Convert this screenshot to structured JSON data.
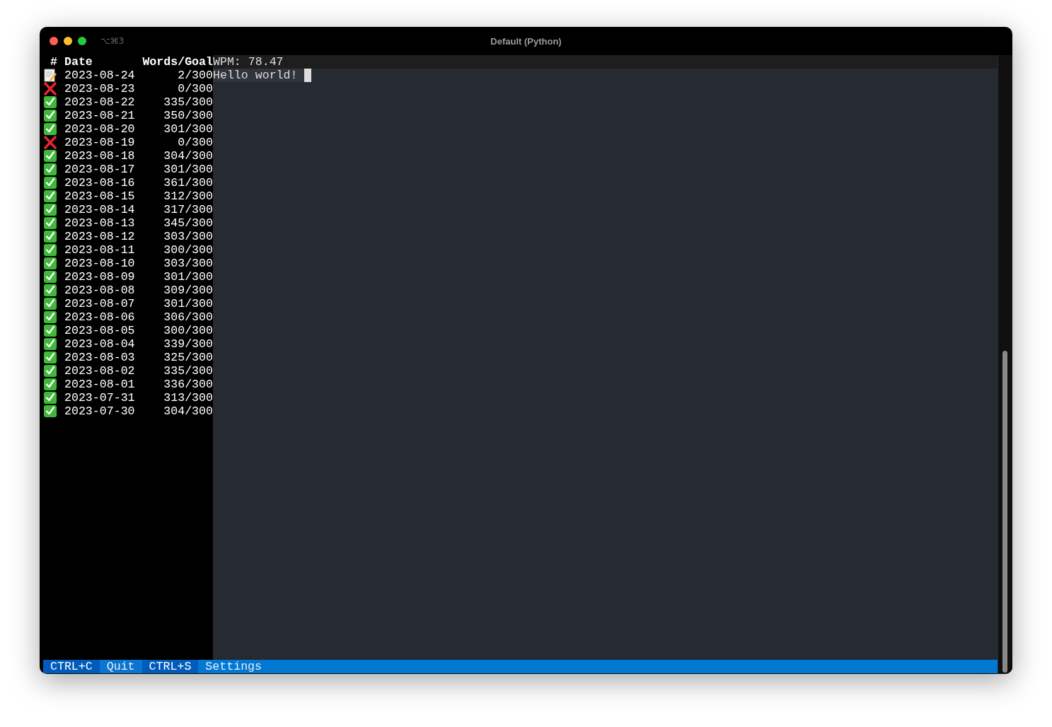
{
  "window": {
    "title": "Default (Python)",
    "shortcut": "⌥⌘3"
  },
  "log": {
    "columns": [
      "#",
      "Date",
      "Words/Goal"
    ],
    "rows": [
      {
        "kind": "draft",
        "date": "2023-08-24",
        "words": "2/300"
      },
      {
        "kind": "missed",
        "date": "2023-08-23",
        "words": "0/300"
      },
      {
        "kind": "done",
        "date": "2023-08-22",
        "words": "335/300"
      },
      {
        "kind": "done",
        "date": "2023-08-21",
        "words": "350/300"
      },
      {
        "kind": "done",
        "date": "2023-08-20",
        "words": "301/300"
      },
      {
        "kind": "missed",
        "date": "2023-08-19",
        "words": "0/300"
      },
      {
        "kind": "done",
        "date": "2023-08-18",
        "words": "304/300"
      },
      {
        "kind": "done",
        "date": "2023-08-17",
        "words": "301/300"
      },
      {
        "kind": "done",
        "date": "2023-08-16",
        "words": "361/300"
      },
      {
        "kind": "done",
        "date": "2023-08-15",
        "words": "312/300"
      },
      {
        "kind": "done",
        "date": "2023-08-14",
        "words": "317/300"
      },
      {
        "kind": "done",
        "date": "2023-08-13",
        "words": "345/300"
      },
      {
        "kind": "done",
        "date": "2023-08-12",
        "words": "303/300"
      },
      {
        "kind": "done",
        "date": "2023-08-11",
        "words": "300/300"
      },
      {
        "kind": "done",
        "date": "2023-08-10",
        "words": "303/300"
      },
      {
        "kind": "done",
        "date": "2023-08-09",
        "words": "301/300"
      },
      {
        "kind": "done",
        "date": "2023-08-08",
        "words": "309/300"
      },
      {
        "kind": "done",
        "date": "2023-08-07",
        "words": "301/300"
      },
      {
        "kind": "done",
        "date": "2023-08-06",
        "words": "306/300"
      },
      {
        "kind": "done",
        "date": "2023-08-05",
        "words": "300/300"
      },
      {
        "kind": "done",
        "date": "2023-08-04",
        "words": "339/300"
      },
      {
        "kind": "done",
        "date": "2023-08-03",
        "words": "325/300"
      },
      {
        "kind": "done",
        "date": "2023-08-02",
        "words": "335/300"
      },
      {
        "kind": "done",
        "date": "2023-08-01",
        "words": "336/300"
      },
      {
        "kind": "done",
        "date": "2023-07-31",
        "words": "313/300"
      },
      {
        "kind": "done",
        "date": "2023-07-30",
        "words": "304/300"
      }
    ]
  },
  "editor": {
    "stats": "WPM: 78.47",
    "text": "Hello world!"
  },
  "footer": [
    {
      "key": "CTRL+C",
      "label": "Quit"
    },
    {
      "key": "CTRL+S",
      "label": "Settings"
    }
  ]
}
